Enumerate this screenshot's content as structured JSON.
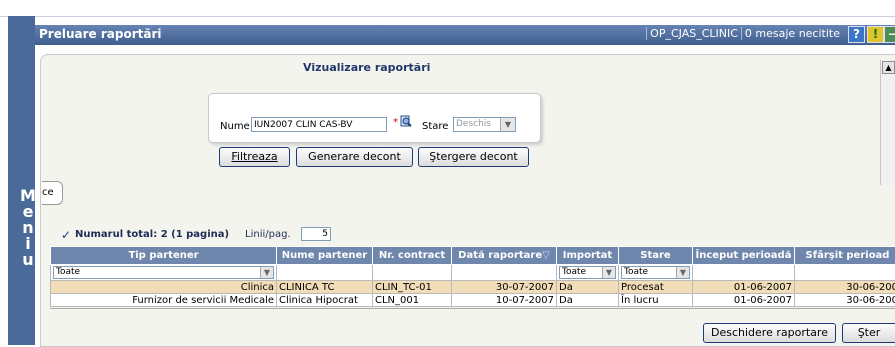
{
  "header": {
    "title": "Preluare raportări",
    "user": "OP_CJAS_CLINIC",
    "messages": "0 mesaje necitite",
    "help_label": "?",
    "warn_label": "!",
    "min_label": "−"
  },
  "menu": {
    "label": [
      "M",
      "e",
      "n",
      "i",
      "u"
    ]
  },
  "filter": {
    "title": "Vizualizare raportări",
    "name_label": "Nume",
    "name_value": "IUN2007 CLIN CAS-BV",
    "required_mark": "*",
    "state_label": "Stare",
    "state_value": "Deschis",
    "buttons": {
      "filter": "Filtreaza",
      "generate": "Generare decont",
      "delete": "Ştergere decont"
    }
  },
  "tab_label": "ce",
  "summary": {
    "total": "Numarul total: 2 (1 pagina)",
    "rows_label": "Linii/pag.",
    "rows_value": "5"
  },
  "table": {
    "headers": [
      "Tip partener",
      "Nume partener",
      "Nr. contract",
      "Dată raportare",
      "Importat",
      "Stare",
      "Început perioadă",
      "Sfârşit perioad"
    ],
    "filter_row": {
      "tip": "Toate",
      "importat": "Toate",
      "stare": "Toate"
    },
    "rows": [
      [
        "Clinica",
        "CLINICA TC",
        "CLIN_TC-01",
        "30-07-2007",
        "Da",
        "Procesat",
        "01-06-2007",
        "30-06-200"
      ],
      [
        "Furnizor de servicii Medicale",
        "Clinica Hipocrat",
        "CLN_001",
        "10-07-2007",
        "Da",
        "În lucru",
        "01-06-2007",
        "30-06-200"
      ]
    ]
  },
  "footer_buttons": {
    "open": "Deschidere raportare",
    "delete": "Şter"
  },
  "colors": {
    "title_bar": "#4f6d9f",
    "table_header": "#6f86ad",
    "selected_row": "#f1ddb7",
    "menu_strip": "#4a6a99"
  }
}
